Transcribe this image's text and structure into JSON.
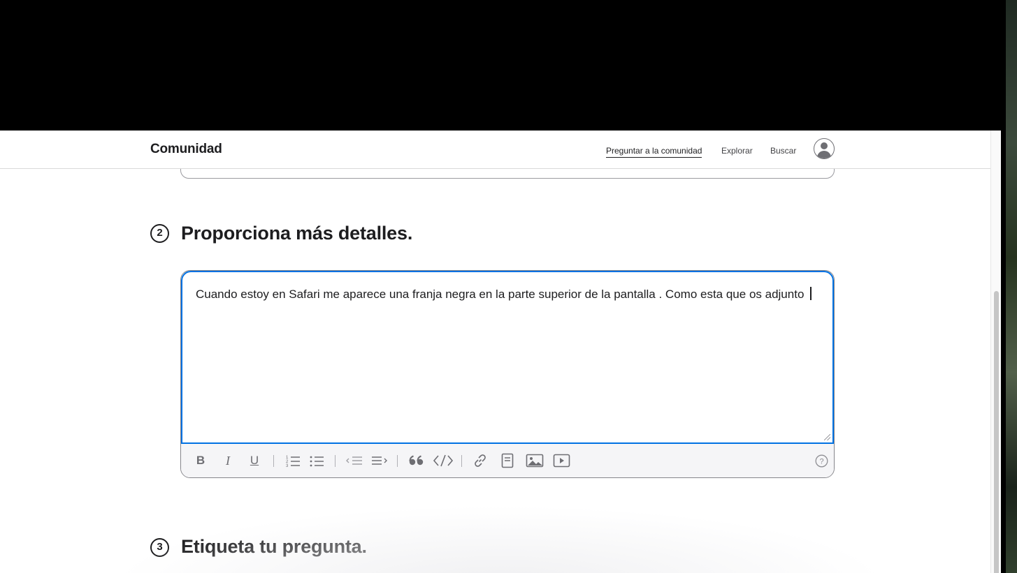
{
  "navbar": {
    "brand": "Comunidad",
    "links": [
      {
        "label": "Preguntar a la comunidad",
        "active": true
      },
      {
        "label": "Explorar",
        "active": false
      },
      {
        "label": "Buscar",
        "active": false
      }
    ],
    "avatar_icon": "user-circle-icon"
  },
  "steps": [
    {
      "number": "2",
      "title": "Proporciona más detalles."
    },
    {
      "number": "3",
      "title": "Etiqueta tu pregunta."
    }
  ],
  "editor": {
    "value": "Cuando estoy en Safari me aparece una franja negra en la parte superior de la pantalla . Como esta que os adjunto ",
    "focus_color": "#0071e3",
    "toolbar": {
      "bold": "B",
      "italic": "I",
      "underline": "U",
      "icons": [
        "bold-icon",
        "italic-icon",
        "underline-icon",
        "numbered-list-icon",
        "bullet-list-icon",
        "outdent-icon",
        "indent-icon",
        "quote-icon",
        "code-icon",
        "link-icon",
        "document-icon",
        "image-icon",
        "video-icon",
        "help-icon"
      ]
    }
  }
}
